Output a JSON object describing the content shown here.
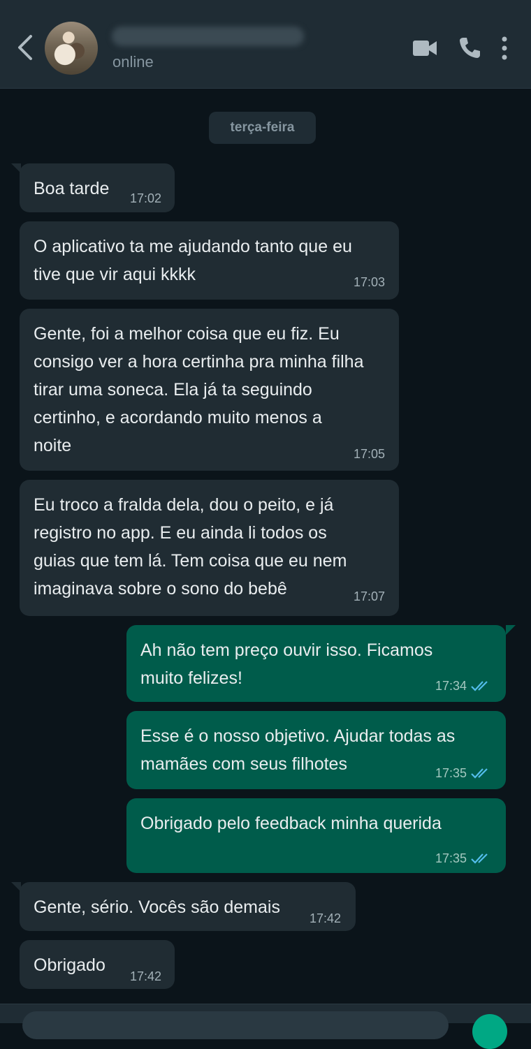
{
  "header": {
    "status": "online",
    "icons": [
      "back-arrow-icon",
      "video-call-icon",
      "voice-call-icon",
      "more-options-icon"
    ]
  },
  "chat": {
    "date_label": "terça-feira",
    "messages": [
      {
        "direction": "in",
        "text": "Boa tarde",
        "time": "17:02"
      },
      {
        "direction": "in",
        "text": "O aplicativo ta me ajudando tanto que eu\ntive que vir aqui kkkk",
        "time": "17:03"
      },
      {
        "direction": "in",
        "text": "Gente, foi a melhor coisa que eu fiz. Eu\nconsigo ver a hora certinha pra minha filha\ntirar uma soneca. Ela já ta seguindo\ncertinho, e acordando muito menos a\nnoite",
        "time": "17:05"
      },
      {
        "direction": "in",
        "text": "Eu troco a fralda dela, dou o peito, e já\nregistro no app. E eu ainda li todos os\nguias que tem lá. Tem coisa que eu nem\nimaginava sobre o sono do bebê",
        "time": "17:07"
      },
      {
        "direction": "out",
        "text": "Ah não tem preço ouvir isso. Ficamos\nmuito felizes!",
        "time": "17:34",
        "status": "read"
      },
      {
        "direction": "out",
        "text": "Esse é o nosso objetivo. Ajudar todas as\nmamães com seus filhotes",
        "time": "17:35",
        "status": "read"
      },
      {
        "direction": "out",
        "text": "Obrigado pelo feedback minha querida",
        "time": "17:35",
        "status": "read"
      },
      {
        "direction": "in",
        "text": "Gente, sério. Vocês são demais",
        "time": "17:42"
      },
      {
        "direction": "in",
        "text": "Obrigado",
        "time": "17:42"
      }
    ]
  },
  "colors": {
    "background": "#0b141a",
    "header": "#1f2c34",
    "incoming_bubble": "#202c33",
    "outgoing_bubble": "#005c4b",
    "read_ticks": "#53bdeb",
    "accent": "#00a884"
  }
}
